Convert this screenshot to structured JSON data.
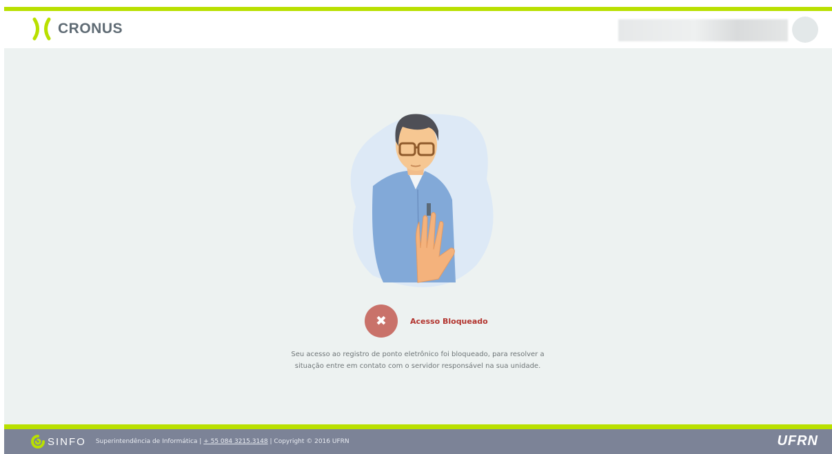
{
  "header": {
    "logo_text": "CRONUS",
    "brand_color": "#b9e000"
  },
  "main": {
    "status_icon": "close-icon",
    "status_glyph": "✖",
    "status_title": "Acesso Bloqueado",
    "message_line1": "Seu acesso ao registro de ponto eletrônico foi bloqueado, para resolver a",
    "message_line2": "situação entre em contato com o servidor responsável na sua unidade.",
    "status_color": "#c9726a"
  },
  "footer": {
    "sinfo_text": "SINFO",
    "dept": "Superintendência de Informática |",
    "phone": "+ 55 084 3215.3148",
    "copyright": "| Copyright © 2016  UFRN",
    "ufrn_logo": "UFRN",
    "background_color": "#7c8397"
  }
}
